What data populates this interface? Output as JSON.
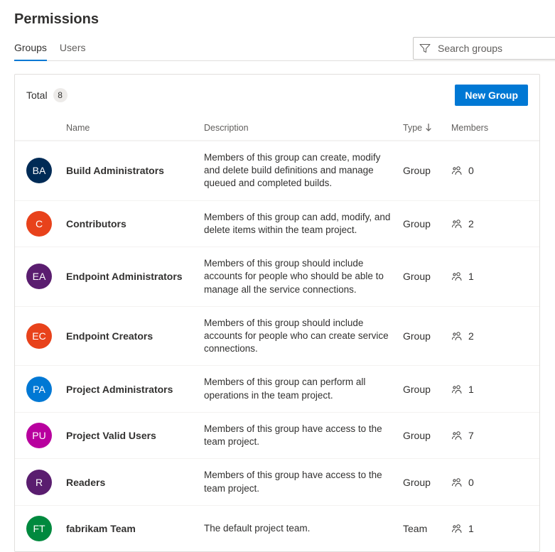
{
  "page": {
    "title": "Permissions"
  },
  "tabs": {
    "groups": "Groups",
    "users": "Users",
    "active": "groups"
  },
  "search": {
    "placeholder": "Search groups",
    "value": ""
  },
  "card": {
    "total_label": "Total",
    "total_count": "8",
    "new_group_label": "New Group"
  },
  "columns": {
    "name": "Name",
    "description": "Description",
    "type": "Type",
    "members": "Members"
  },
  "rows": [
    {
      "initials": "BA",
      "color": "#002b56",
      "name": "Build Administrators",
      "description": "Members of this group can create, modify and delete build definitions and manage queued and completed builds.",
      "type": "Group",
      "members": "0"
    },
    {
      "initials": "C",
      "color": "#e8421b",
      "name": "Contributors",
      "description": "Members of this group can add, modify, and delete items within the team project.",
      "type": "Group",
      "members": "2"
    },
    {
      "initials": "EA",
      "color": "#5a1d6f",
      "name": "Endpoint Administrators",
      "description": "Members of this group should include accounts for people who should be able to manage all the service connections.",
      "type": "Group",
      "members": "1"
    },
    {
      "initials": "EC",
      "color": "#e8421b",
      "name": "Endpoint Creators",
      "description": "Members of this group should include accounts for people who can create service connections.",
      "type": "Group",
      "members": "2"
    },
    {
      "initials": "PA",
      "color": "#0078d4",
      "name": "Project Administrators",
      "description": "Members of this group can perform all operations in the team project.",
      "type": "Group",
      "members": "1"
    },
    {
      "initials": "PU",
      "color": "#b8009e",
      "name": "Project Valid Users",
      "description": "Members of this group have access to the team project.",
      "type": "Group",
      "members": "7"
    },
    {
      "initials": "R",
      "color": "#5a1d6f",
      "name": "Readers",
      "description": "Members of this group have access to the team project.",
      "type": "Group",
      "members": "0"
    },
    {
      "initials": "FT",
      "color": "#00893e",
      "name": "fabrikam Team",
      "description": "The default project team.",
      "type": "Team",
      "members": "1"
    }
  ]
}
